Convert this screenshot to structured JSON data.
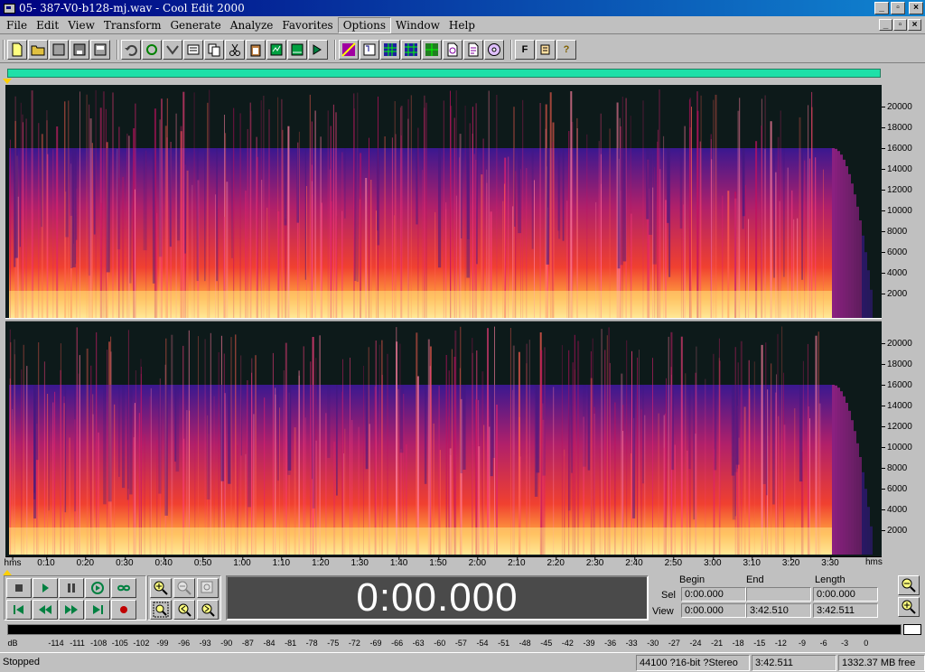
{
  "window": {
    "title": "05- 387-V0-b128-mj.wav - Cool Edit 2000",
    "minimize": "_",
    "maximize": "▫",
    "close": "×"
  },
  "menu": [
    "File",
    "Edit",
    "View",
    "Transform",
    "Generate",
    "Analyze",
    "Favorites",
    "Options",
    "Window",
    "Help"
  ],
  "menu_active": "Options",
  "toolbar": {
    "groups": [
      [
        "new-icon",
        "open-icon",
        "close-file-icon",
        "save-icon",
        "save-all-icon"
      ],
      [
        "undo-icon",
        "repeat-icon",
        "mix-paste-icon",
        "cut-icon-2",
        "copy-icon",
        "cut-icon",
        "paste-icon",
        "paste-special-icon",
        "trim-icon",
        "play-mix-icon"
      ],
      [
        "spectral-icon",
        "waveform-icon",
        "grid-icon-1",
        "grid-icon-2",
        "grid-icon-3",
        "cue-icon",
        "document-icon",
        "cd-icon"
      ],
      [
        "f-icon",
        "script-icon",
        "help-icon"
      ]
    ],
    "f_label": "F",
    "help_label": "?"
  },
  "frequency_scale": [
    "20000",
    "18000",
    "16000",
    "14000",
    "12000",
    "10000",
    "8000",
    "6000",
    "4000",
    "2000"
  ],
  "time_ruler": {
    "unit": "hms",
    "ticks": [
      "0:10",
      "0:20",
      "0:30",
      "0:40",
      "0:50",
      "1:00",
      "1:10",
      "1:20",
      "1:30",
      "1:40",
      "1:50",
      "2:00",
      "2:10",
      "2:20",
      "2:30",
      "2:40",
      "2:50",
      "3:00",
      "3:10",
      "3:20",
      "3:30"
    ]
  },
  "time_display": "0:00.000",
  "selection": {
    "headers": {
      "begin": "Begin",
      "end": "End",
      "length": "Length"
    },
    "sel": {
      "label": "Sel",
      "begin": "0:00.000",
      "end": "",
      "length": "0:00.000"
    },
    "view": {
      "label": "View",
      "begin": "0:00.000",
      "end": "3:42.510",
      "length": "3:42.511"
    }
  },
  "level_meter": {
    "unit": "dB",
    "ticks": [
      "-114",
      "-111",
      "-108",
      "-105",
      "-102",
      "-99",
      "-96",
      "-93",
      "-90",
      "-87",
      "-84",
      "-81",
      "-78",
      "-75",
      "-72",
      "-69",
      "-66",
      "-63",
      "-60",
      "-57",
      "-54",
      "-51",
      "-48",
      "-45",
      "-42",
      "-39",
      "-36",
      "-33",
      "-30",
      "-27",
      "-24",
      "-21",
      "-18",
      "-15",
      "-12",
      "-9",
      "-6",
      "-3",
      "0"
    ]
  },
  "status": {
    "state": "Stopped",
    "format": "44100 ?16-bit ?Stereo",
    "duration": "3:42.511",
    "free_space": "1332.37 MB free"
  },
  "colors": {
    "title_gradient_start": "#000080",
    "title_gradient_end": "#1084d0",
    "overview": "#1ee0a8",
    "spectral_background": "#0d1a1a",
    "spectral_high": "#ffe080",
    "spectral_mid": "#ff3c40",
    "spectral_low": "#4020a0"
  }
}
